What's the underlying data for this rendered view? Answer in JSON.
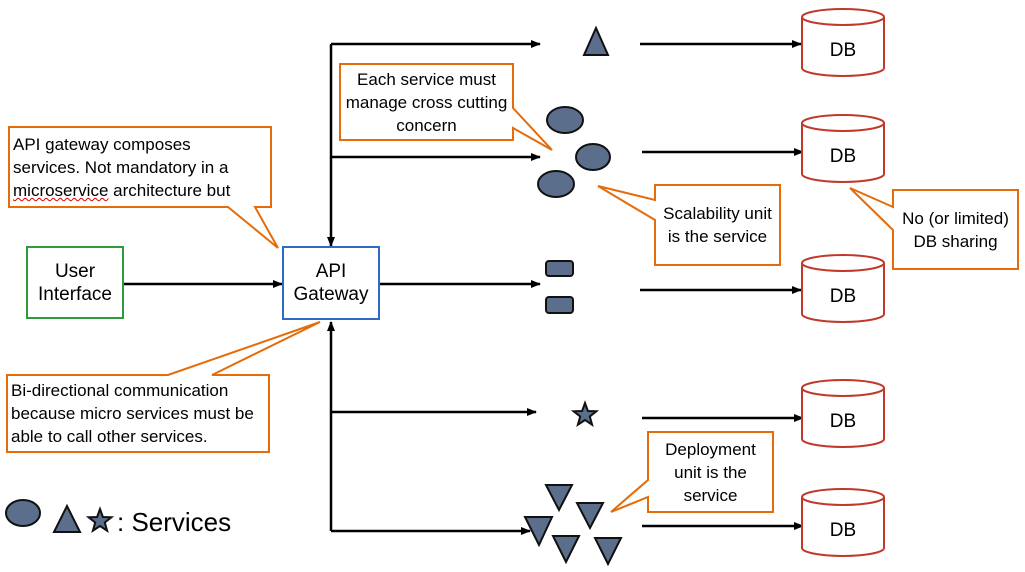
{
  "colors": {
    "callout": "#E46C0A",
    "db": "#C0392B",
    "service_fill": "#5B6E8C",
    "ui_border": "#2E9B3C",
    "gateway_border": "#2F6BC4"
  },
  "user_interface": {
    "label": "User Interface"
  },
  "api_gateway": {
    "label": "API Gateway"
  },
  "databases": [
    {
      "label": "DB"
    },
    {
      "label": "DB"
    },
    {
      "label": "DB"
    },
    {
      "label": "DB"
    },
    {
      "label": "DB"
    }
  ],
  "callouts": {
    "gateway_composes": {
      "line1": "API gateway composes",
      "line2": "services. Not mandatory in a",
      "line3_word": "microservice",
      "line3_rest": " architecture but"
    },
    "cross_cutting": "Each service must manage cross cutting concern",
    "scalability": "Scalability unit is the service",
    "db_sharing": "No (or limited) DB sharing",
    "bidirectional": "Bi-directional communication because micro services must be able to call other services.",
    "deployment": "Deployment unit is the service"
  },
  "legend": {
    "label": ": Services",
    "icons": [
      "ellipse-icon",
      "triangle-icon",
      "star-icon"
    ]
  }
}
